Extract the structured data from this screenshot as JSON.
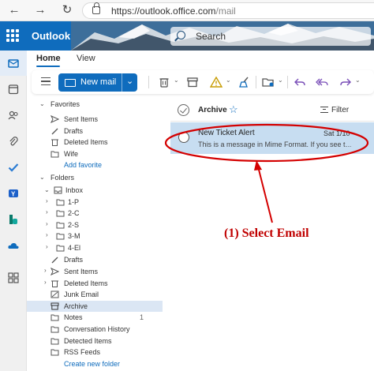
{
  "browser": {
    "url_main": "https://outlook.office.com",
    "url_dim": "/mail"
  },
  "header": {
    "app_name": "Outlook",
    "search_placeholder": "Search"
  },
  "ribbon": {
    "tabs": [
      "Home",
      "View"
    ],
    "new_mail": "New mail"
  },
  "folders": {
    "favorites_title": "Favorites",
    "favorites": [
      "Sent Items",
      "Drafts",
      "Deleted Items",
      "Wife"
    ],
    "add_favorite": "Add favorite",
    "folders_title": "Folders",
    "inbox": "Inbox",
    "inbox_children": [
      "1-P",
      "2-C",
      "2-S",
      "3-M",
      "4-El"
    ],
    "others": [
      "Drafts",
      "Sent Items",
      "Deleted Items",
      "Junk Email",
      "Archive"
    ],
    "notes": "Notes",
    "notes_count": "1",
    "more": [
      "Conversation History",
      "Detected Items",
      "RSS Feeds"
    ],
    "create_new_folder": "Create new folder"
  },
  "list": {
    "title": "Archive",
    "filter": "Filter",
    "message": {
      "sender": "New Ticket Alert",
      "date": "Sat 1/10",
      "preview": "This is a message in Mime Format.  If you see t…"
    }
  },
  "annotation": {
    "label": "(1) Select Email",
    "color": "#cc0000"
  }
}
